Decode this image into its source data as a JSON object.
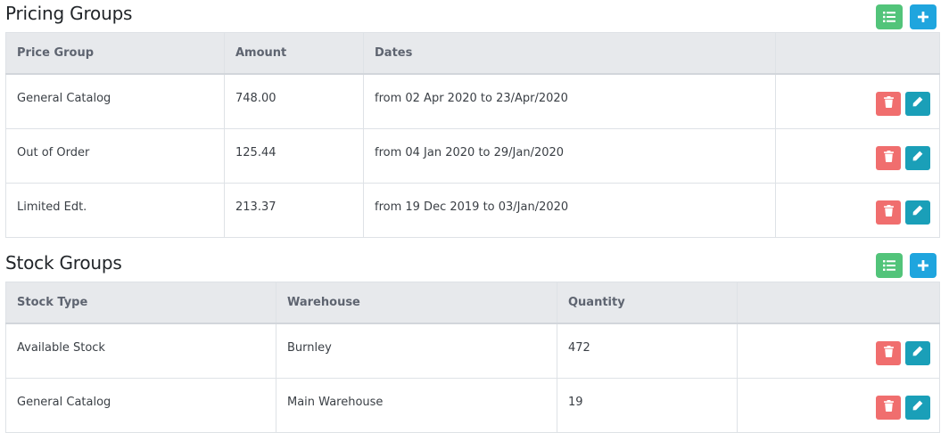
{
  "colors": {
    "list_button": "#52c47a",
    "add_button": "#1fa5de",
    "delete_button": "#f06e6e",
    "edit_button": "#1a9fb8",
    "header_bg": "#e7e9ec"
  },
  "icons": {
    "list": "list-icon",
    "add": "plus-icon",
    "delete": "trash-icon",
    "edit": "pencil-icon"
  },
  "pricing": {
    "title": "Pricing Groups",
    "headers": [
      "Price Group",
      "Amount",
      "Dates",
      ""
    ],
    "rows": [
      {
        "group": "General Catalog",
        "amount": "748.00",
        "dates": "from 02 Apr 2020 to 23/Apr/2020"
      },
      {
        "group": "Out of Order",
        "amount": "125.44",
        "dates": "from 04 Jan 2020 to 29/Jan/2020"
      },
      {
        "group": "Limited Edt.",
        "amount": "213.37",
        "dates": "from 19 Dec 2019 to 03/Jan/2020"
      }
    ]
  },
  "stock": {
    "title": "Stock Groups",
    "headers": [
      "Stock Type",
      "Warehouse",
      "Quantity",
      ""
    ],
    "rows": [
      {
        "type": "Available Stock",
        "warehouse": "Burnley",
        "quantity": "472"
      },
      {
        "type": "General Catalog",
        "warehouse": "Main Warehouse",
        "quantity": "19"
      }
    ]
  }
}
